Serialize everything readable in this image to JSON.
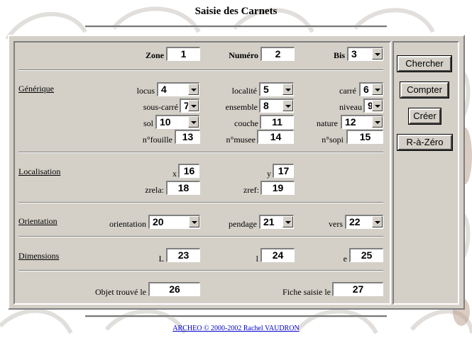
{
  "title": "Saisie des Carnets",
  "header": {
    "zone_label": "Zone",
    "zone_value": "1",
    "numero_label": "Numéro",
    "numero_value": "2",
    "bis_label": "Bis",
    "bis_value": "3"
  },
  "generique": {
    "section_label": "Générique",
    "locus_label": "locus",
    "locus_value": "4",
    "localite_label": "localité",
    "localite_value": "5",
    "carre_label": "carré",
    "carre_value": "6",
    "souscarre_label": "sous-carré",
    "souscarre_value": "7",
    "ensemble_label": "ensemble",
    "ensemble_value": "8",
    "niveau_label": "niveau",
    "niveau_value": "9",
    "sol_label": "sol",
    "sol_value": "10",
    "couche_label": "couche",
    "couche_value": "11",
    "nature_label": "nature",
    "nature_value": "12",
    "nfouille_label": "n°fouille",
    "nfouille_value": "13",
    "nmusee_label": "n°musee",
    "nmusee_value": "14",
    "nsopi_label": "n°sopi",
    "nsopi_value": "15"
  },
  "localisation": {
    "section_label": "Localisation",
    "x_label": "x",
    "x_value": "16",
    "y_label": "y",
    "y_value": "17",
    "zrela_label": "zrela:",
    "zrela_value": "18",
    "zref_label": "zref:",
    "zref_value": "19"
  },
  "orientation": {
    "section_label": "Orientation",
    "orientation_label": "orientation",
    "orientation_value": "20",
    "pendage_label": "pendage",
    "pendage_value": "21",
    "vers_label": "vers",
    "vers_value": "22"
  },
  "dimensions": {
    "section_label": "Dimensions",
    "L_label": "L",
    "L_value": "23",
    "l_label": "l",
    "l_value": "24",
    "e_label": "e",
    "e_value": "25"
  },
  "bottom": {
    "objet_label": "Objet trouvé le",
    "objet_value": "26",
    "fiche_label": "Fiche saisie le",
    "fiche_value": "27"
  },
  "buttons": {
    "chercher": "Chercher",
    "compter": "Compter",
    "creer": "Créer",
    "raz": "R-à-Zéro"
  },
  "footer": "ARCHEO © 2000-2002 Rachel VAUDRON"
}
